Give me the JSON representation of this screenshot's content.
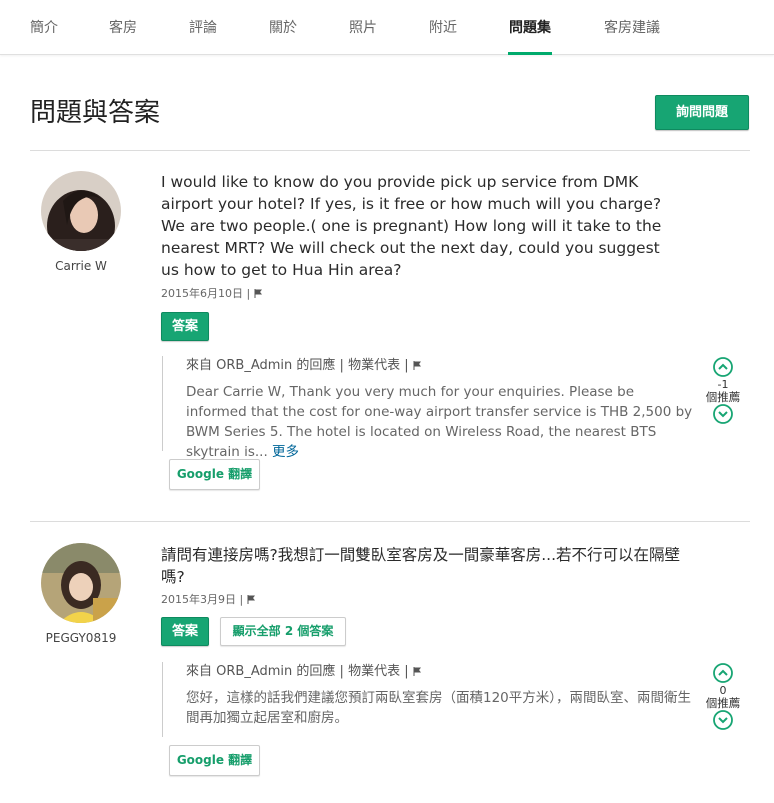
{
  "tabs": [
    {
      "label": "簡介"
    },
    {
      "label": "客房"
    },
    {
      "label": "評論"
    },
    {
      "label": "關於"
    },
    {
      "label": "照片"
    },
    {
      "label": "附近"
    },
    {
      "label": "問題集",
      "active": true
    },
    {
      "label": "客房建議"
    }
  ],
  "page_title": "問題與答案",
  "ask_button": "詢問問題",
  "accent_color": "#17a573",
  "questions": [
    {
      "user": "Carrie W",
      "text": "I would like to know do you provide pick up service from DMK airport your hotel? If yes, is it free or how much will you charge? We are two people.( one is pregnant) How long will it take to the nearest MRT? We will check out the next day, could you suggest us how to get to Hua Hin area?",
      "date": "2015年6月10日",
      "separator": "|",
      "answer_button": "答案",
      "reply": {
        "from": "來自 ORB_Admin 的回應",
        "role": "物業代表",
        "separator": "|",
        "text": "Dear Carrie W, Thank you very much for your enquiries. Please be informed that the cost for one-way airport transfer service is THB 2,500 by BWM Series 5. The hotel is located on Wireless Road, the nearest BTS skytrain is...",
        "more": "更多"
      },
      "votes": {
        "count": "-1",
        "label": "個推薦"
      },
      "google_translate": "Google 翻譯"
    },
    {
      "user": "PEGGY0819",
      "text": "請問有連接房嗎?我想訂一間雙臥室客房及一間豪華客房...若不行可以在隔壁嗎?",
      "date": "2015年3月9日",
      "separator": "|",
      "answer_button": "答案",
      "show_all_button": "顯示全部 2 個答案",
      "reply": {
        "from": "來自 ORB_Admin 的回應",
        "role": "物業代表",
        "separator": "|",
        "text": "您好，這樣的話我們建議您預訂兩臥室套房（面積120平方米），兩間臥室、兩間衛生間再加獨立起居室和廚房。"
      },
      "votes": {
        "count": "0",
        "label": "個推薦"
      },
      "google_translate": "Google 翻譯"
    }
  ]
}
